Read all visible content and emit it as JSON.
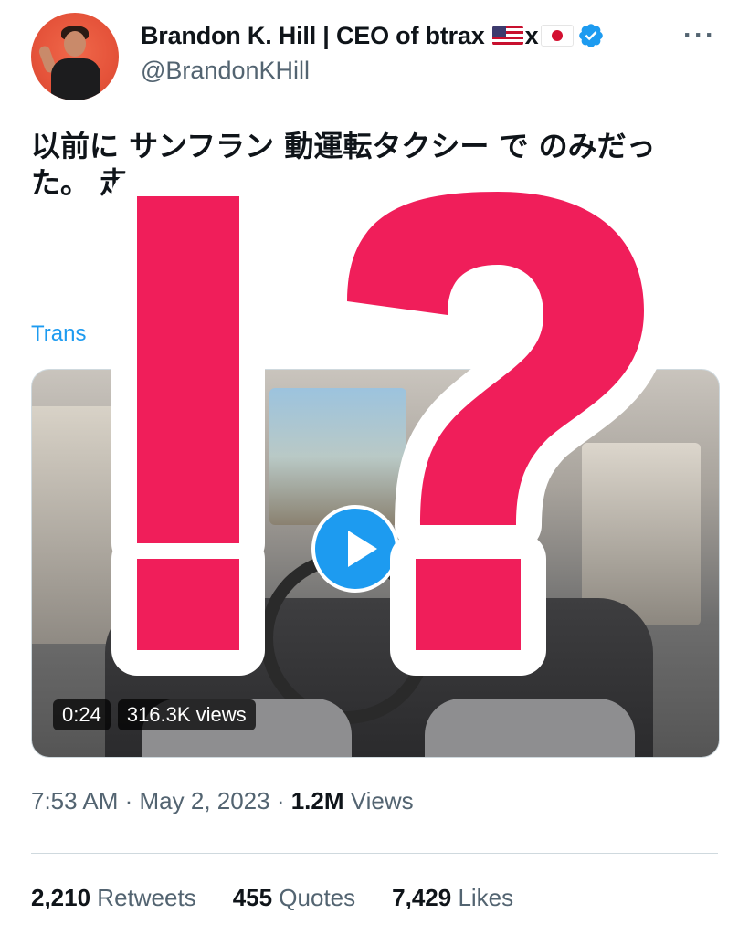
{
  "author": {
    "display_name": "Brandon K. Hill | CEO of btrax",
    "flag_separator": "x",
    "handle": "@BrandonKHill"
  },
  "tweet": {
    "text": "以前に サンフラン 動運転タクシー で のみだっ た。 走っ",
    "translate_label": "Trans"
  },
  "video": {
    "duration": "0:24",
    "views": "316.3K views"
  },
  "meta": {
    "time": "7:53 AM",
    "sep1": " · ",
    "date": "May 2, 2023",
    "sep2": " · ",
    "views_count": "1.2M",
    "views_label": " Views"
  },
  "stats": {
    "retweets_count": "2,210",
    "retweets_label": " Retweets",
    "quotes_count": "455",
    "quotes_label": " Quotes",
    "likes_count": "7,429",
    "likes_label": " Likes"
  },
  "overlay": {
    "color": "#f01e5a"
  },
  "icons": {
    "verified": "verified-badge-icon",
    "more": "more-options-icon",
    "play": "play-icon"
  }
}
